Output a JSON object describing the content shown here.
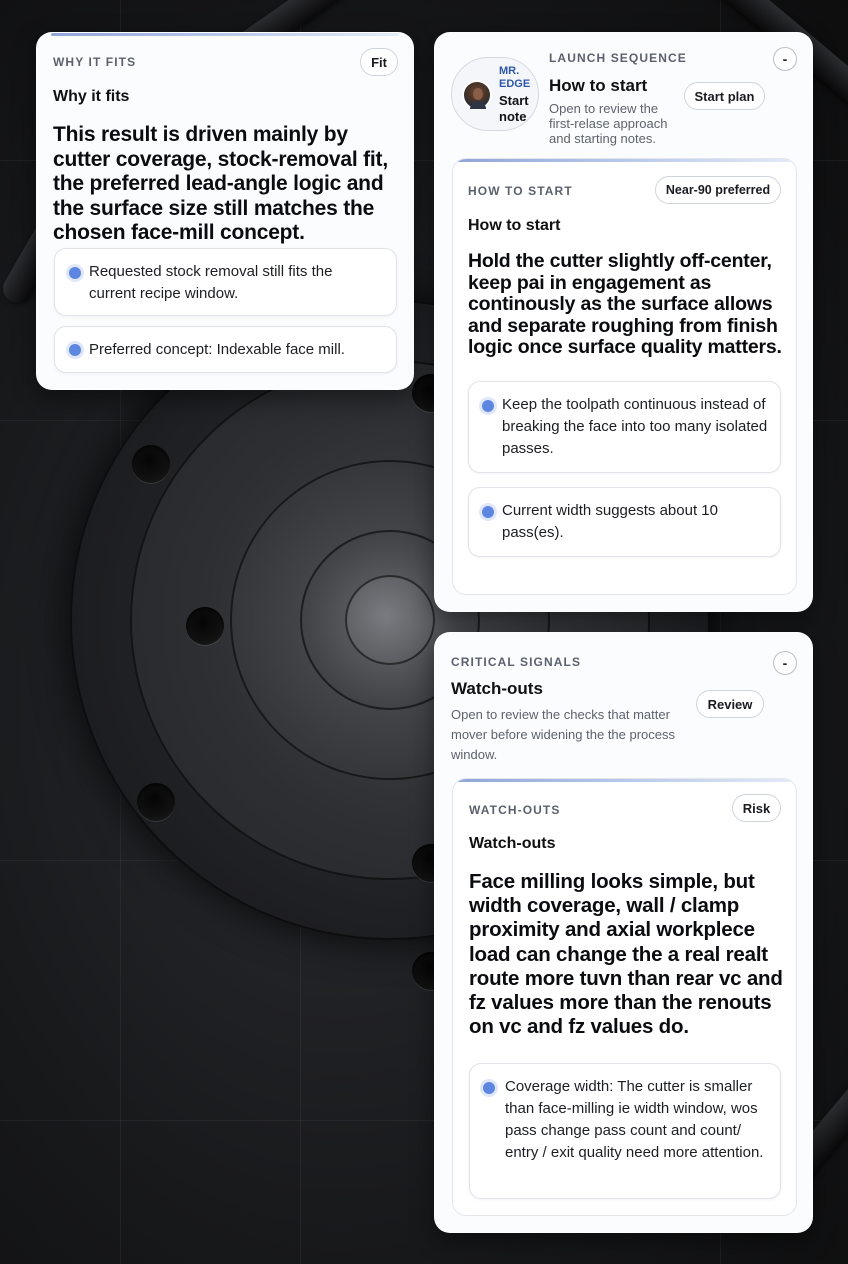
{
  "why_card": {
    "eyebrow": "WHY IT FITS",
    "pill": "Fit",
    "subtitle": "Why it fits",
    "headline": "This result is driven mainly by cutter coverage, stock-removal fit, the preferred lead-angle logic and the surface size still matches the chosen face-mill concept.",
    "bullets": [
      "Requested stock removal still fits the current recipe window.",
      "Preferred concept: Indexable face mill."
    ]
  },
  "launch_card": {
    "eyebrow": "LAUNCH SEQUENCE",
    "avatar_caption_top": "MR.",
    "avatar_caption_mid": "EDGE",
    "avatar_caption_start": "Start",
    "avatar_caption_note": "note",
    "title": "How to start",
    "description": "Open to review the first-relase approach and starting notes.",
    "pill": "Start plan",
    "collapse_glyph": "-",
    "inner": {
      "eyebrow": "HOW TO START",
      "pill": "Near-90 preferred",
      "subtitle": "How to start",
      "headline": "Hold the cutter slightly off-center, keep pai in engagement as continously as the surface allows and separate roughing from finish logic once surface quality matters.",
      "bullets": [
        "Keep the toolpath continuous instead of breaking the face into too many isolated passes.",
        "Current width suggests about 10 pass(es)."
      ]
    }
  },
  "critical_card": {
    "eyebrow": "CRITICAL SIGNALS",
    "title": "Watch-outs",
    "description": "Open to review the checks that matter mover before widening the the process window.",
    "pill": "Review",
    "collapse_glyph": "-",
    "inner": {
      "eyebrow": "WATCH-OUTS",
      "pill": "Risk",
      "subtitle": "Watch-outs",
      "headline": "Face milling looks simple, but width coverage, wall / clamp proximity and axial workplece load can change the a real realt route more tuvn than rear vc and fz values more than the renouts on vc and fz values do.",
      "bullets": [
        "Coverage width: The cutter is smaller than face-milling ie width window, wos pass change pass count and count/ entry / exit quality need more attention."
      ]
    }
  },
  "colors": {
    "accent": "#5d86e0",
    "card": "#fbfcfe",
    "background": "#141416"
  }
}
